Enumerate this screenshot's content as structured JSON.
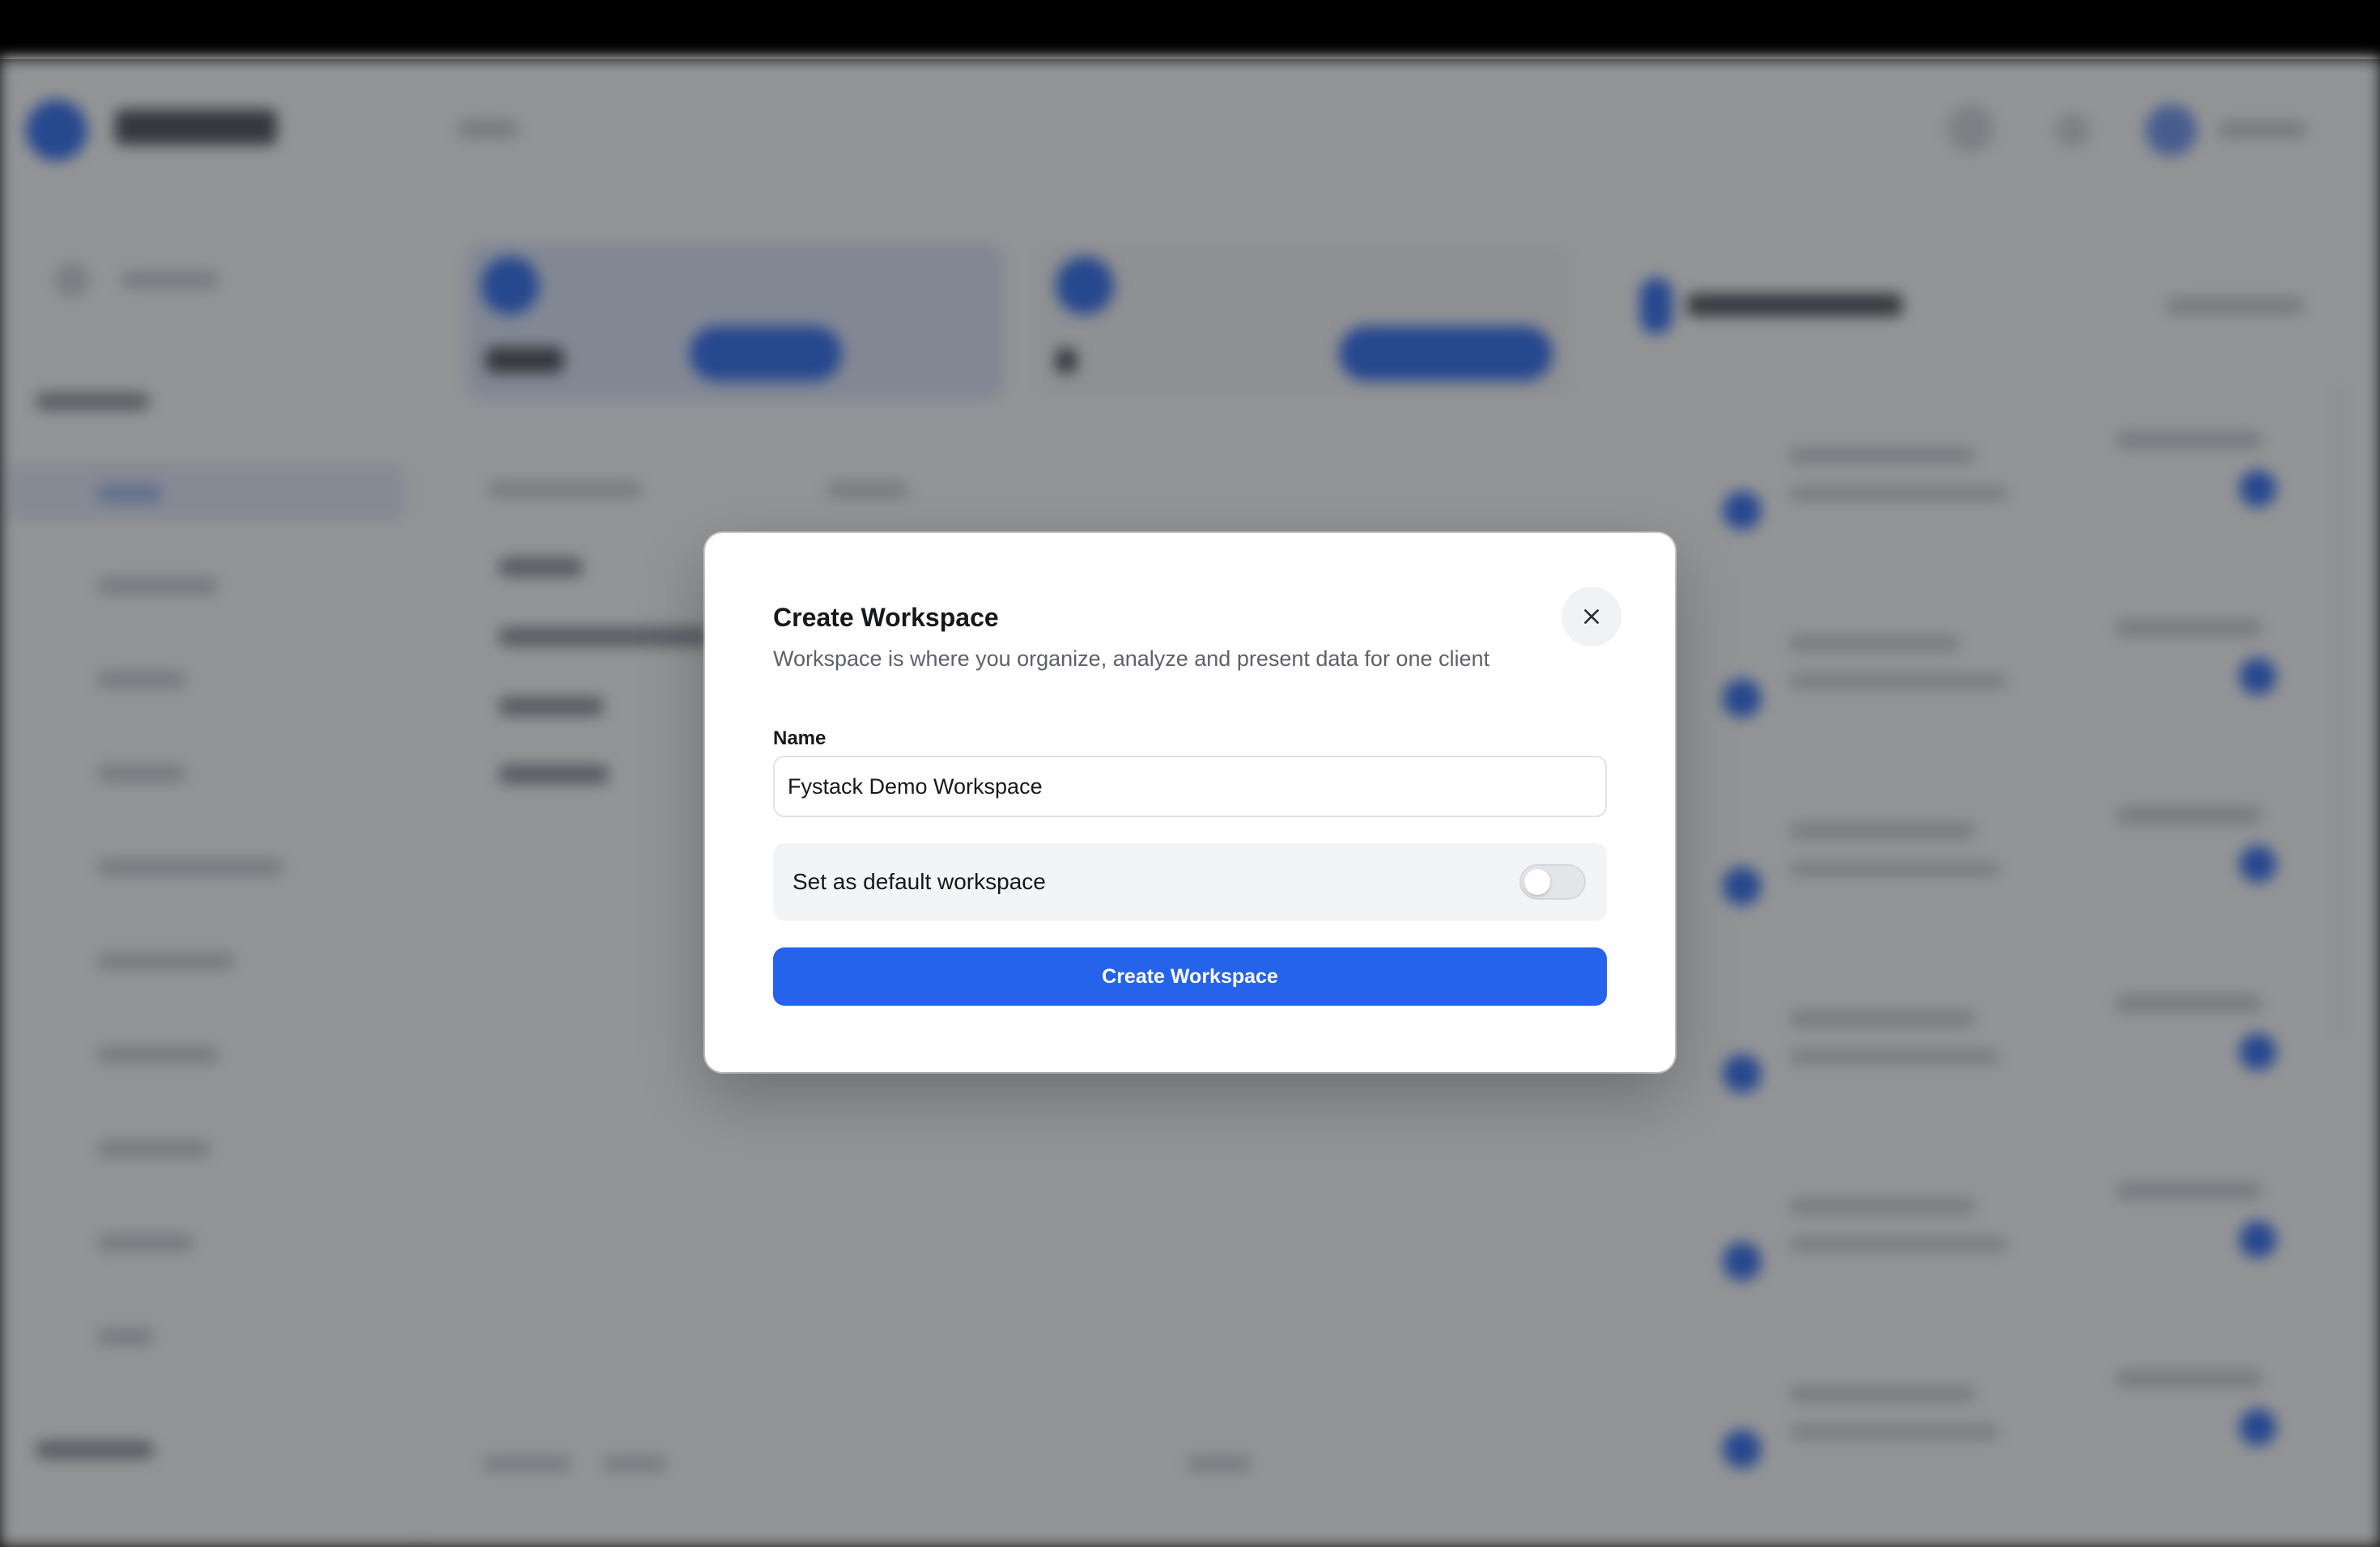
{
  "modal": {
    "title": "Create Workspace",
    "subtitle": "Workspace is where you organize, analyze and present data for one client",
    "close_icon": "close-icon",
    "name_label": "Name",
    "name_value": "Fystack Demo Workspace",
    "default_toggle_label": "Set as default workspace",
    "default_toggle_on": false,
    "submit_label": "Create Workspace",
    "colors": {
      "primary": "#2563eb",
      "overlay": "rgba(30,32,36,0.48)"
    }
  }
}
